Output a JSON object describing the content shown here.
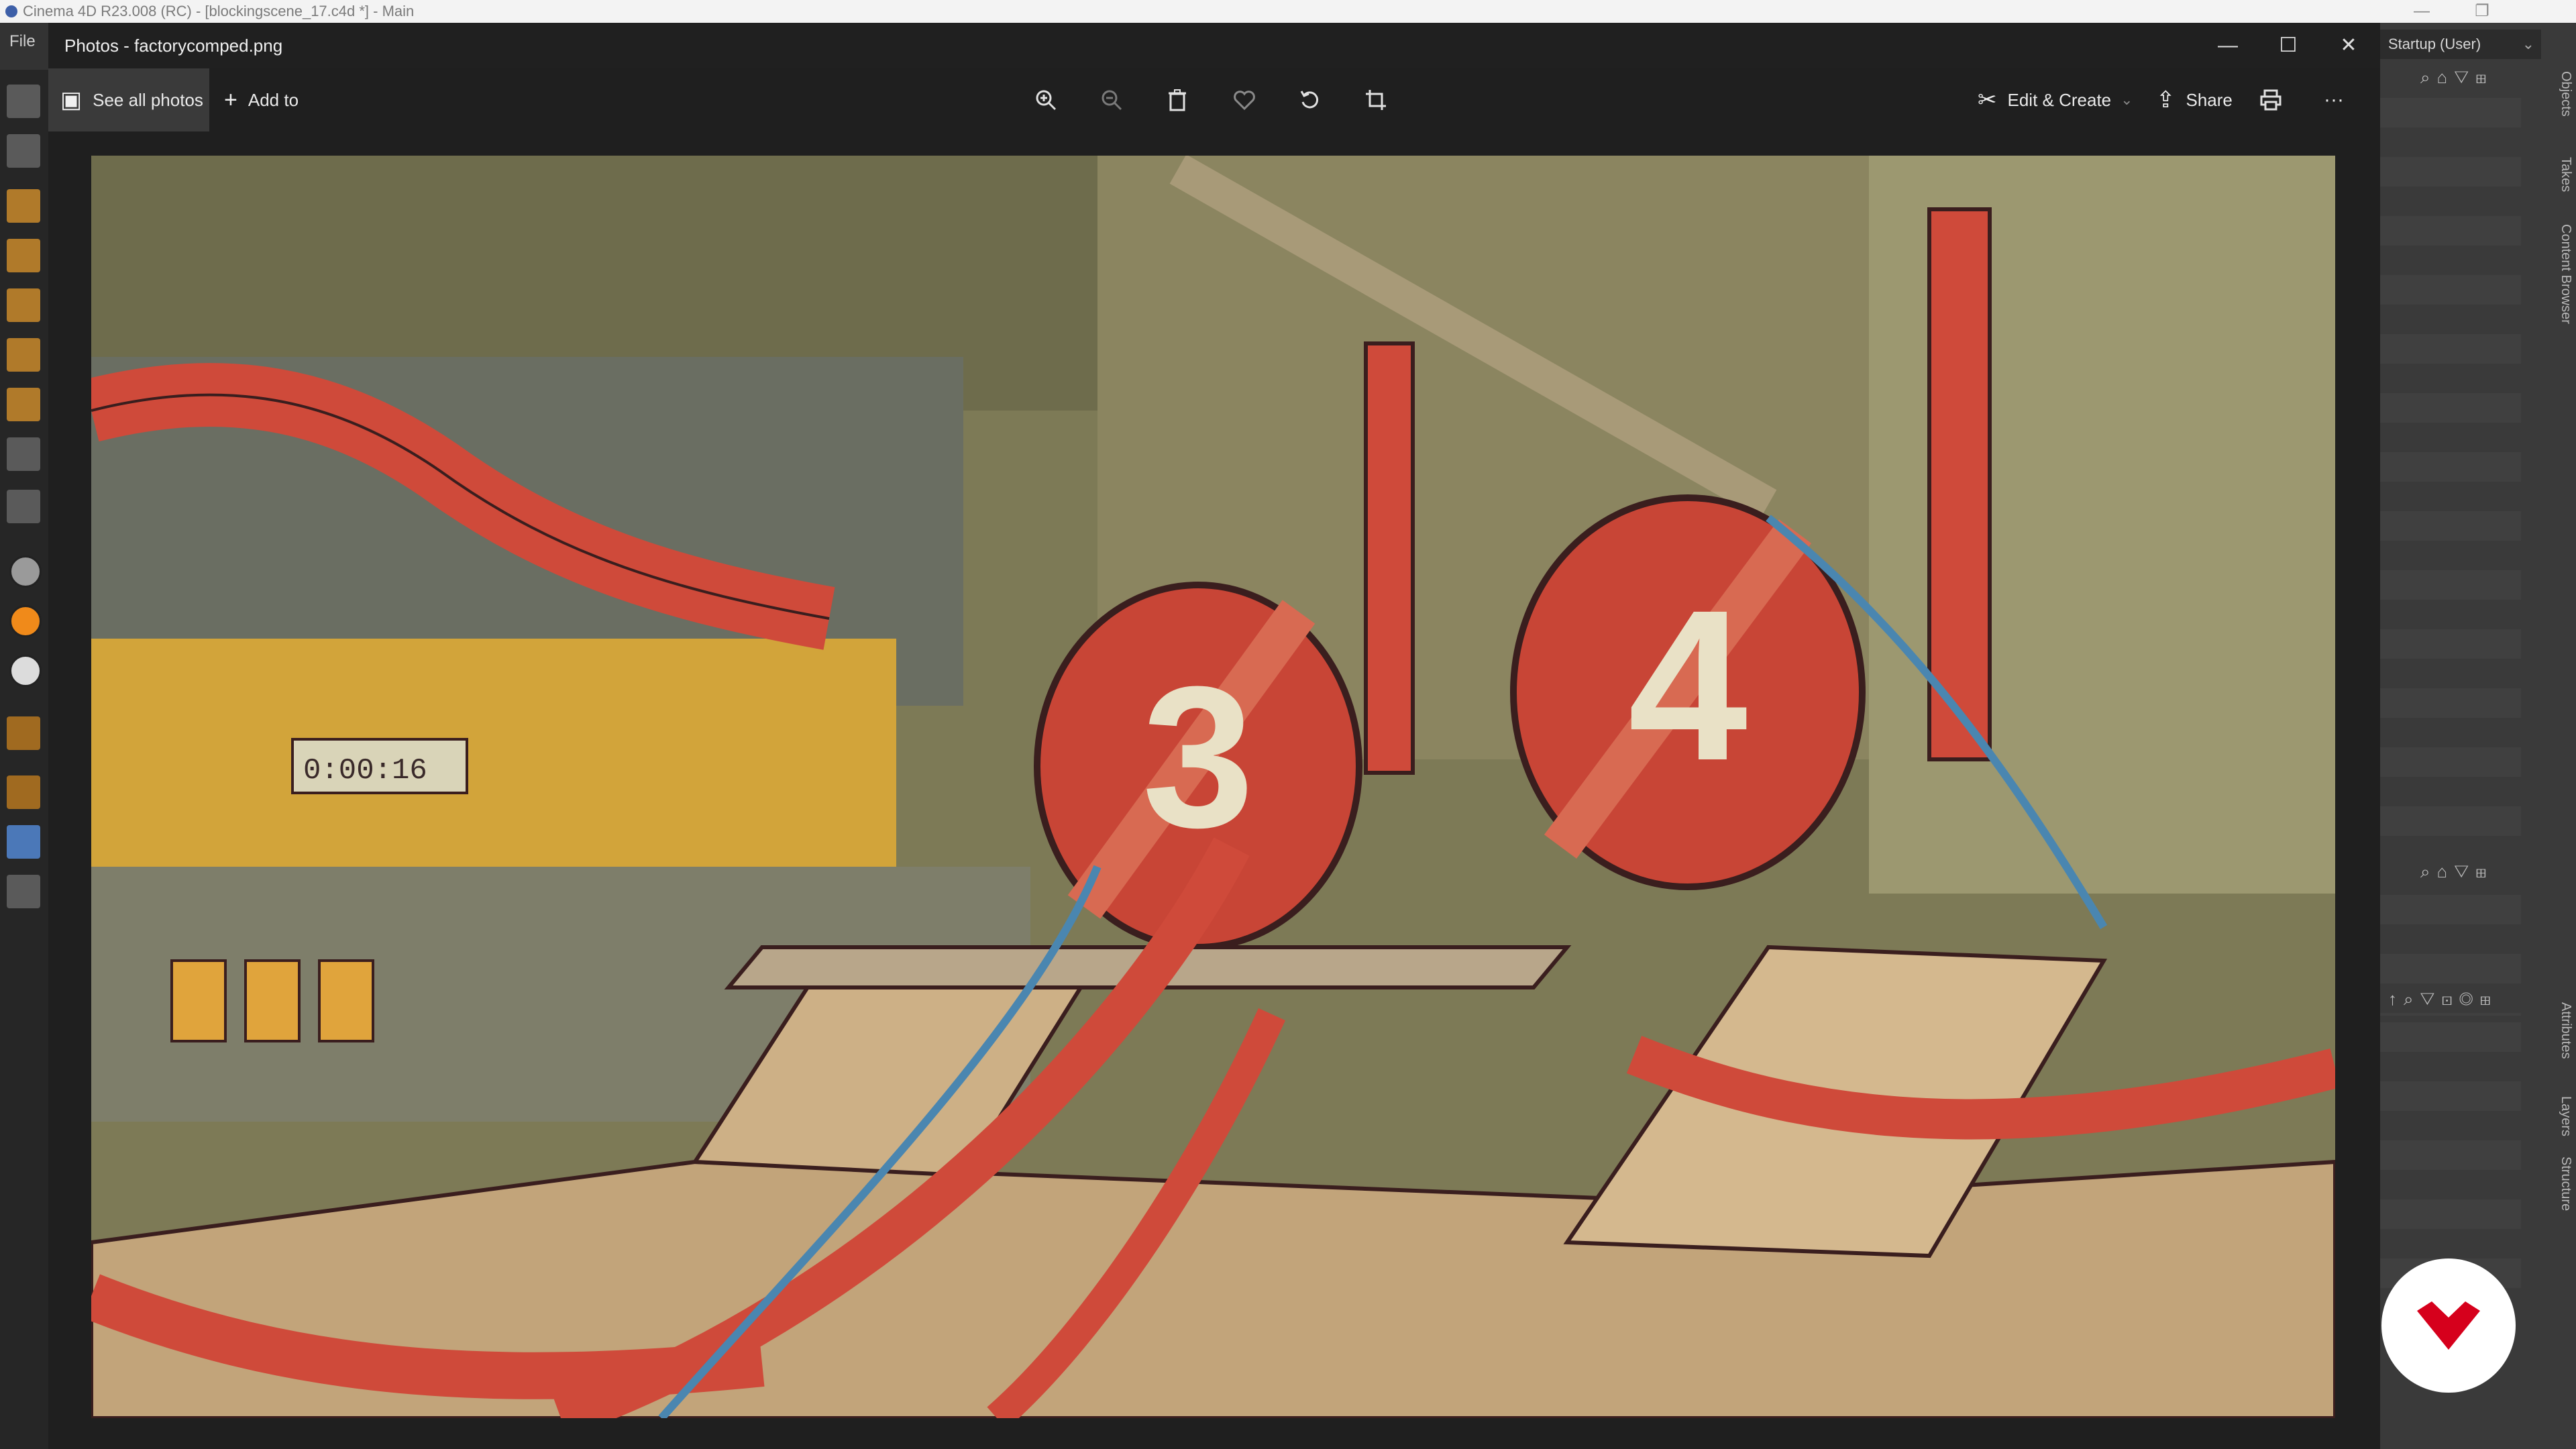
{
  "c4d": {
    "window_title": "Cinema 4D R23.008 (RC) - [blockingscene_17.c4d *] - Main",
    "menu_file": "File",
    "layout_label": "Startup (User)",
    "tabs_top": [
      "Objects",
      "Takes",
      "Content Browser"
    ],
    "tabs_bottom": [
      "Attributes",
      "Layers",
      "Structure"
    ],
    "minimize_symbol": "—",
    "restore_symbol": "❐"
  },
  "photos": {
    "title": "Photos - factorycomped.png",
    "see_all_label": "See all photos",
    "add_to_label": "Add to",
    "edit_create_label": "Edit & Create",
    "share_label": "Share",
    "more_label": "···",
    "minimize_symbol": "—",
    "maximize_symbol": "☐",
    "close_symbol": "✕"
  },
  "image": {
    "tank_left_number": "3",
    "tank_right_number": "4",
    "display_readout": "0:00:16"
  },
  "colors": {
    "accent_red": "#cf4a3a",
    "sky_olive": "#7d7a56",
    "floor_tan": "#c2a47a",
    "outline": "#3a1e1e"
  },
  "icons": {
    "zoom_in": "zoom-in-icon",
    "zoom_out": "zoom-out-icon",
    "delete": "trash-icon",
    "favorite": "heart-icon",
    "rotate": "rotate-icon",
    "crop": "crop-icon",
    "print": "print-icon"
  }
}
